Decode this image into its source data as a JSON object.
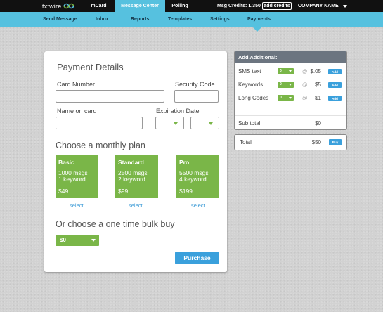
{
  "brand": {
    "logo_text": "txtwire"
  },
  "topnav": {
    "tabs": [
      {
        "label": "mCard",
        "active": false
      },
      {
        "label": "Message Center",
        "active": true
      },
      {
        "label": "Polling",
        "active": false
      }
    ],
    "credits_label": "Msg Credits: 1,350",
    "add_credits_label": "add credits",
    "company_label": "COMPANY NAME"
  },
  "subnav": {
    "items": [
      {
        "label": "Send Message"
      },
      {
        "label": "Inbox"
      },
      {
        "label": "Reports"
      },
      {
        "label": "Templates"
      },
      {
        "label": "Settings"
      },
      {
        "label": "Payments",
        "active": true
      }
    ]
  },
  "payment": {
    "title": "Payment Details",
    "card_number_label": "Card Number",
    "security_code_label": "Security Code",
    "name_on_card_label": "Name on card",
    "expiration_label": "Expiration Date",
    "card_number_value": "",
    "security_code_value": "",
    "name_on_card_value": "",
    "plan_title": "Choose a monthly plan",
    "plans": [
      {
        "name": "Basic",
        "msgs": "1000 msgs",
        "keywords": "1 keyword",
        "price": "$49",
        "select_label": "select"
      },
      {
        "name": "Standard",
        "msgs": "2500 msgs",
        "keywords": "2 keyword",
        "price": "$99",
        "select_label": "select"
      },
      {
        "name": "Pro",
        "msgs": "5500 msgs",
        "keywords": "4 keyword",
        "price": "$199",
        "select_label": "select"
      }
    ],
    "bulk_title": "Or choose a one time bulk buy",
    "bulk_value": "$0",
    "purchase_label": "Purchase"
  },
  "addons": {
    "title": "Add Additional:",
    "rows": [
      {
        "name": "SMS text",
        "qty": "0",
        "at": "@",
        "price": "$.05",
        "button": "Add"
      },
      {
        "name": "Keywords",
        "qty": "0",
        "at": "@",
        "price": "$5",
        "button": "Add"
      },
      {
        "name": "Long Codes",
        "qty": "0",
        "at": "@",
        "price": "$1",
        "button": "Add"
      }
    ],
    "subtotal_label": "Sub total",
    "subtotal_value": "$0",
    "total_label": "Total",
    "total_value": "$50",
    "buy_label": "Buy"
  },
  "colors": {
    "topbar": "#111111",
    "accent_blue": "#56c1df",
    "plan_green": "#7ab648",
    "button_blue": "#3aa0dc",
    "addon_header": "#6c7580"
  }
}
